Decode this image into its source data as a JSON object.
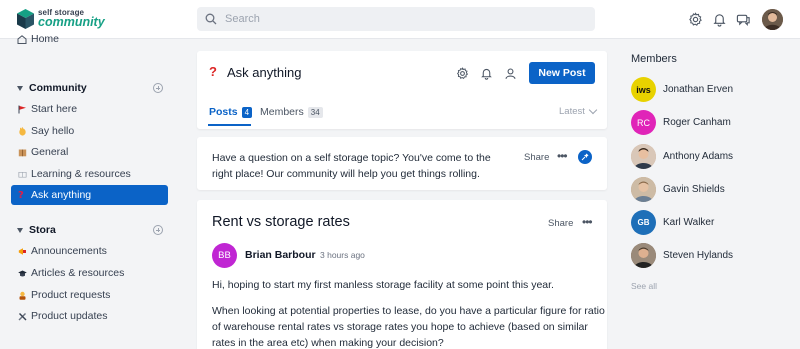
{
  "header": {
    "logo_line1": "self storage",
    "logo_line2": "community",
    "search_placeholder": "Search"
  },
  "sidebar": {
    "home": "Home",
    "community_section": "Community",
    "community_items": [
      {
        "label": "Start here",
        "icon": "red-flag-icon"
      },
      {
        "label": "Say hello",
        "icon": "waving-hand-icon"
      },
      {
        "label": "General",
        "icon": "package-icon"
      },
      {
        "label": "Learning & resources",
        "icon": "book-icon"
      }
    ],
    "active_item": {
      "label": "Ask anything",
      "icon": "question-icon"
    },
    "stora_section": "Stora",
    "stora_items": [
      {
        "label": "Announcements",
        "icon": "megaphone-icon"
      },
      {
        "label": "Articles & resources",
        "icon": "graduation-cap-icon"
      },
      {
        "label": "Product requests",
        "icon": "person-icon"
      },
      {
        "label": "Product updates",
        "icon": "tools-icon"
      }
    ]
  },
  "channel": {
    "title": "Ask anything",
    "new_post": "New Post",
    "tabs": [
      {
        "label": "Posts",
        "count": "4"
      },
      {
        "label": "Members",
        "count": "34"
      }
    ],
    "sort": "Latest"
  },
  "intro": {
    "text": "Have a question on a self storage topic? You've come to the right place! Our community will help you get things rolling.",
    "share": "Share",
    "more": "•••"
  },
  "post": {
    "title": "Rent vs storage rates",
    "share": "Share",
    "more": "•••",
    "author_initials": "BB",
    "author": "Brian Barbour",
    "time": "3 hours ago",
    "paragraph1": "Hi, hoping to start my first manless storage facility at some point this year.",
    "paragraph2": "When looking at potential properties to lease, do you have a particular figure for ratio of warehouse rental rates vs storage rates you hope to achieve (based on similar rates in the area etc) when making your decision?"
  },
  "members": {
    "title": "Members",
    "list": [
      {
        "name": "Jonathan Erven",
        "initials": "iws",
        "color": "#e8d200"
      },
      {
        "name": "Roger Canham",
        "initials": "RC",
        "color": "#e024b8"
      },
      {
        "name": "Anthony Adams",
        "initials": "",
        "color": "#c9a488"
      },
      {
        "name": "Gavin Shields",
        "initials": "",
        "color": "#b89878"
      },
      {
        "name": "Karl Walker",
        "initials": "GB",
        "color": "#1e6fb8"
      },
      {
        "name": "Steven Hylands",
        "initials": "",
        "color": "#7a6655"
      }
    ],
    "see_all": "See all"
  },
  "colors": {
    "accent": "#0b63c7",
    "question_mark": "#dc2626",
    "brand_green": "#16a085"
  }
}
